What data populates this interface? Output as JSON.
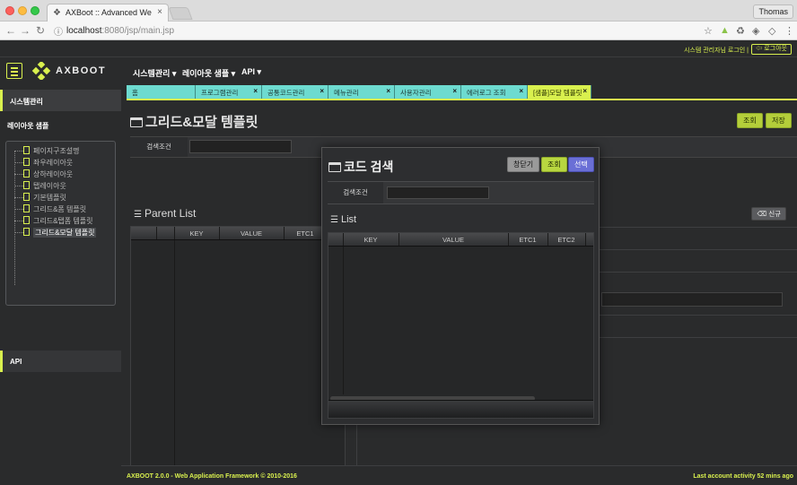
{
  "browser": {
    "tab_title": "AXBoot :: Advanced Web Applic",
    "profile_name": "Thomas",
    "url_host": "localhost",
    "url_rest": ":8080/jsp/main.jsp"
  },
  "userbar": {
    "user_text": "시스템 관리자님 로그인 |",
    "logout_label": "로그아웃"
  },
  "header": {
    "logo_text": "AXBOOT",
    "menus": [
      "시스템관리 ▾",
      "레이아웃 샘플 ▾",
      "API ▾"
    ]
  },
  "sidebar": {
    "system_label": "시스템관리",
    "layout_label": "레이아웃 샘플",
    "tree_items": [
      "페이지구조설명",
      "좌우레이아웃",
      "상하레이아웃",
      "탭레이아웃",
      "기본템플릿",
      "그리드&폼 템플릿",
      "그리드&탭폼 템플릿",
      "그리드&모달 템플릿"
    ],
    "api_label": "API"
  },
  "tabs": [
    {
      "label": "홈",
      "closable": false
    },
    {
      "label": "프로그램관리",
      "closable": true
    },
    {
      "label": "공통코드관리",
      "closable": true
    },
    {
      "label": "메뉴관리",
      "closable": true
    },
    {
      "label": "사용자관리",
      "closable": true
    },
    {
      "label": "에러로그 조회",
      "closable": true
    },
    {
      "label": "[샘플]모달 템플릿",
      "closable": true
    }
  ],
  "page": {
    "title": "그리드&모달 템플릿",
    "search_button": "조회",
    "save_button": "저장",
    "search_label": "검색조건",
    "parent_list_title": "Parent List",
    "new_button": "신규",
    "grid_columns": [
      "KEY",
      "VALUE",
      "ETC1"
    ]
  },
  "modal": {
    "title": "코드 검색",
    "close_button": "창닫기",
    "search_button": "조회",
    "select_button": "선택",
    "search_label": "검색조건",
    "list_title": "List",
    "grid_columns": [
      "KEY",
      "VALUE",
      "ETC1",
      "ETC2"
    ]
  },
  "footer": {
    "left": "AXBOOT 2.0.0 - Web Application Framework © 2010-2016",
    "right": "Last account activity 52 mins ago"
  },
  "colors": {
    "accent": "#d9f04e",
    "tab_bg": "#6ddbd0",
    "select_button": "#6a6fd6"
  }
}
